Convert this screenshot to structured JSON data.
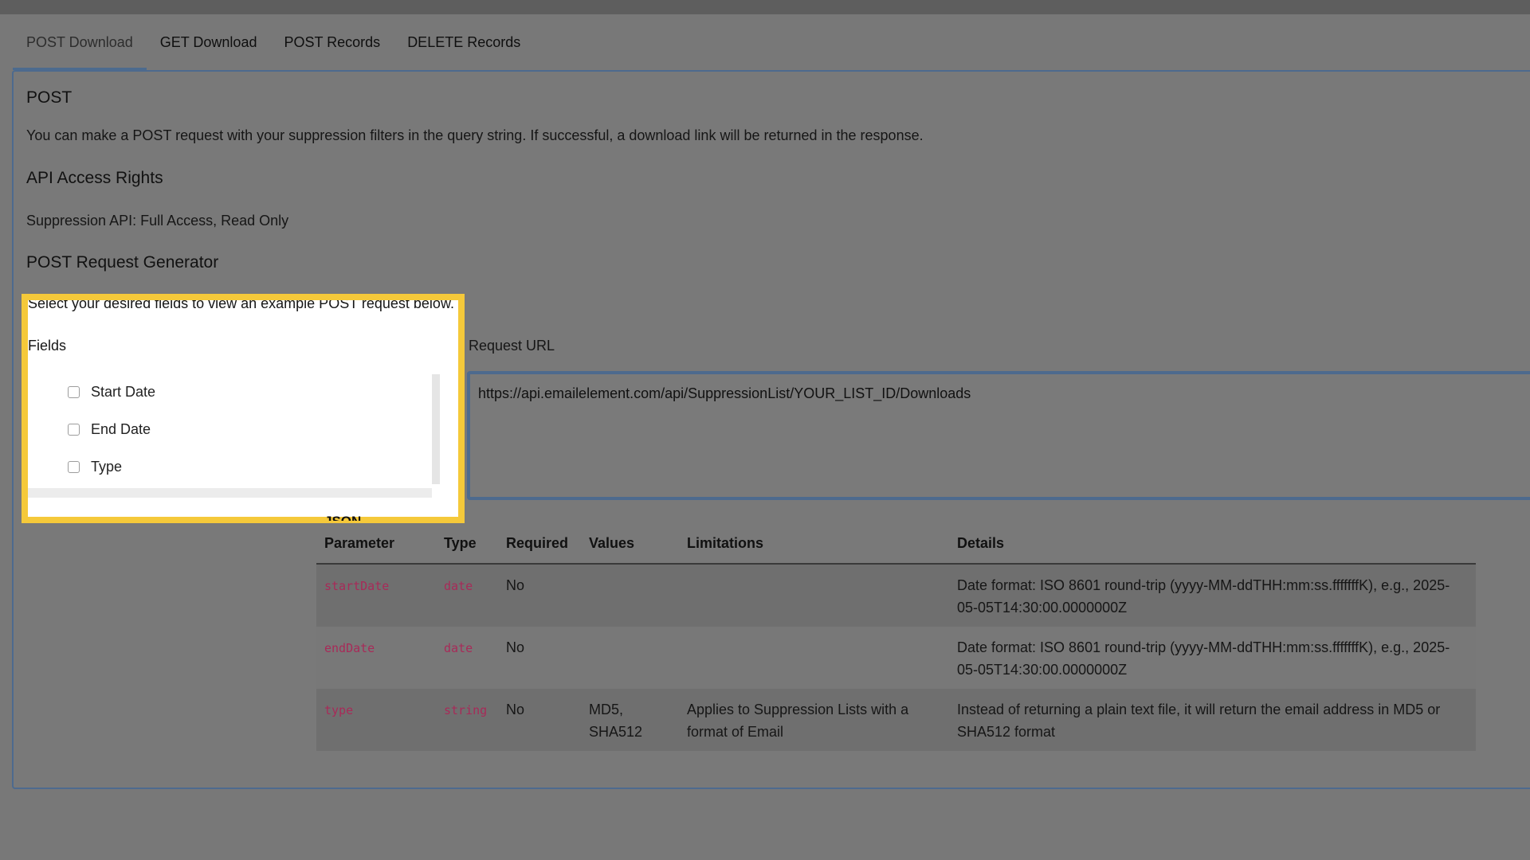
{
  "tabs": [
    "POST Download",
    "GET Download",
    "POST Records",
    "DELETE Records"
  ],
  "section": {
    "title": "POST",
    "description": "You can make a POST request with your suppression filters in the query string. If successful, a download link will be returned in the response.",
    "rights_title": "API Access Rights",
    "rights_text": "Suppression API: Full Access, Read Only",
    "generator_title": "POST Request Generator",
    "generator_hint": "Select your desired fields to view an example POST request below."
  },
  "fields": {
    "label": "Fields",
    "items": [
      "Start Date",
      "End Date",
      "Type"
    ]
  },
  "request": {
    "label": "Request URL",
    "url": "https://api.emailelement.com/api/SuppressionList/YOUR_LIST_ID/Downloads"
  },
  "json_label": "JSON",
  "table": {
    "headers": [
      "Parameter",
      "Type",
      "Required",
      "Values",
      "Limitations",
      "Details"
    ],
    "rows": [
      {
        "parameter": "startDate",
        "type": "date",
        "required": "No",
        "values": "",
        "limitations": "",
        "details": "Date format: ISO 8601 round-trip (yyyy-MM-ddTHH:mm:ss.fffffffK), e.g., 2025-05-05T14:30:00.0000000Z"
      },
      {
        "parameter": "endDate",
        "type": "date",
        "required": "No",
        "values": "",
        "limitations": "",
        "details": "Date format: ISO 8601 round-trip (yyyy-MM-ddTHH:mm:ss.fffffffK), e.g., 2025-05-05T14:30:00.0000000Z"
      },
      {
        "parameter": "type",
        "type": "string",
        "required": "No",
        "values": "MD5, SHA512",
        "limitations": "Applies to Suppression Lists with a format of Email",
        "details": "Instead of returning a plain text file, it will return the email address in MD5 or SHA512 format"
      }
    ]
  },
  "colors": {
    "highlight": "#f5c93a",
    "accent": "#4d6a8e",
    "code": "#a82a58"
  }
}
